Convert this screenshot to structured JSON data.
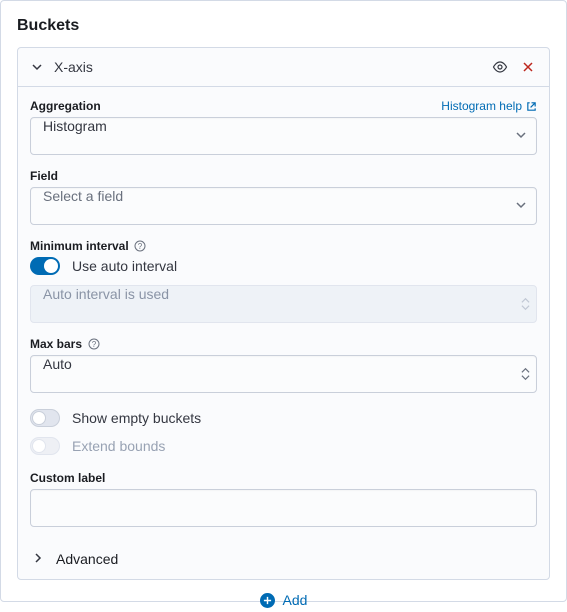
{
  "panel": {
    "title": "Buckets"
  },
  "bucket": {
    "title": "X-axis",
    "aggregation": {
      "label": "Aggregation",
      "help_link": "Histogram help",
      "value": "Histogram"
    },
    "field": {
      "label": "Field",
      "placeholder": "Select a field"
    },
    "min_interval": {
      "label": "Minimum interval",
      "toggle_label": "Use auto interval",
      "toggle_on": true,
      "disabled_text": "Auto interval is used"
    },
    "max_bars": {
      "label": "Max bars",
      "value": "Auto"
    },
    "show_empty": {
      "label": "Show empty buckets",
      "on": false
    },
    "extend_bounds": {
      "label": "Extend bounds",
      "on": false,
      "disabled": true
    },
    "custom_label": {
      "label": "Custom label",
      "value": ""
    },
    "advanced": {
      "label": "Advanced"
    }
  },
  "footer": {
    "add_label": "Add"
  }
}
